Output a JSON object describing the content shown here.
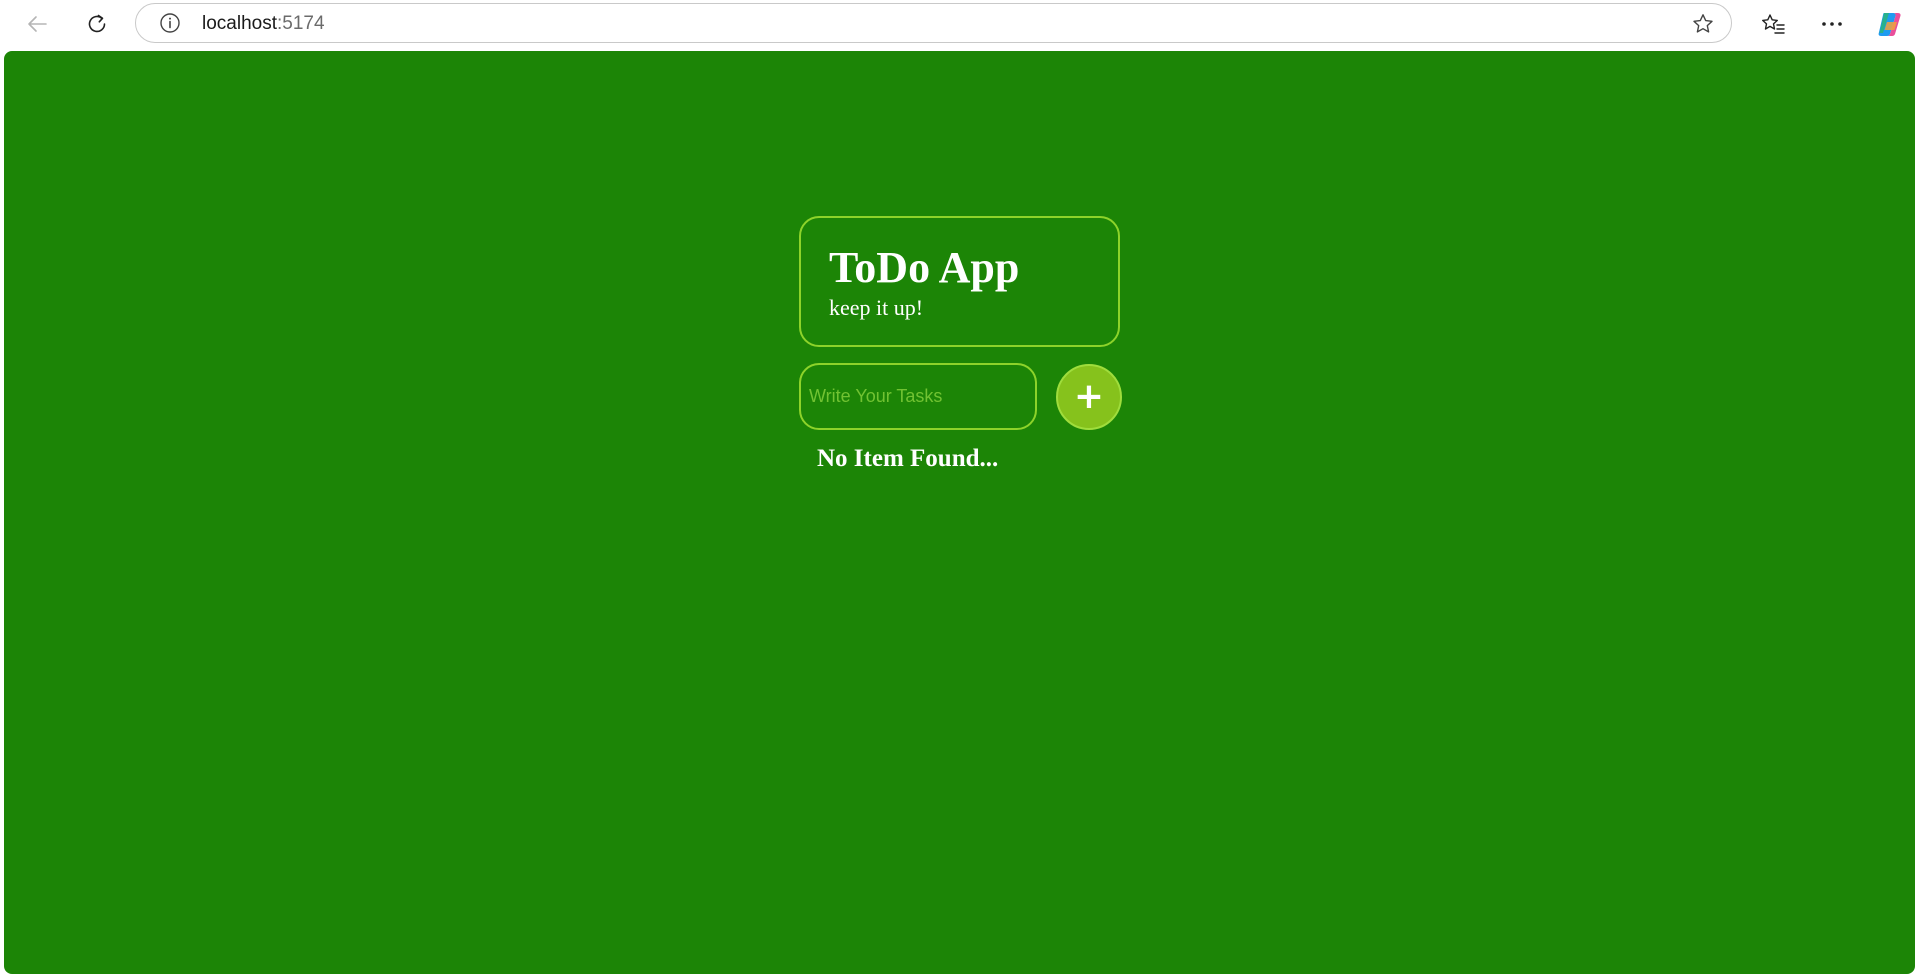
{
  "browser": {
    "url_host": "localhost",
    "url_port": ":5174",
    "icons": {
      "back": "back-arrow-icon",
      "reload": "reload-icon",
      "site_info": "info-icon",
      "favorite": "star-icon",
      "favorites": "favorites-icon",
      "more": "more-dots-icon",
      "copilot": "copilot-icon"
    }
  },
  "app": {
    "title": "ToDo App",
    "subtitle": "keep it up!",
    "input_placeholder": "Write Your Tasks",
    "input_value": "",
    "add_button_label": "+",
    "empty_message": "No Item Found..."
  },
  "colors": {
    "page_background": "#1c8506",
    "border_accent": "#8dd32a",
    "add_button": "#86c21c",
    "placeholder": "#71c232",
    "text": "#ffffff"
  }
}
